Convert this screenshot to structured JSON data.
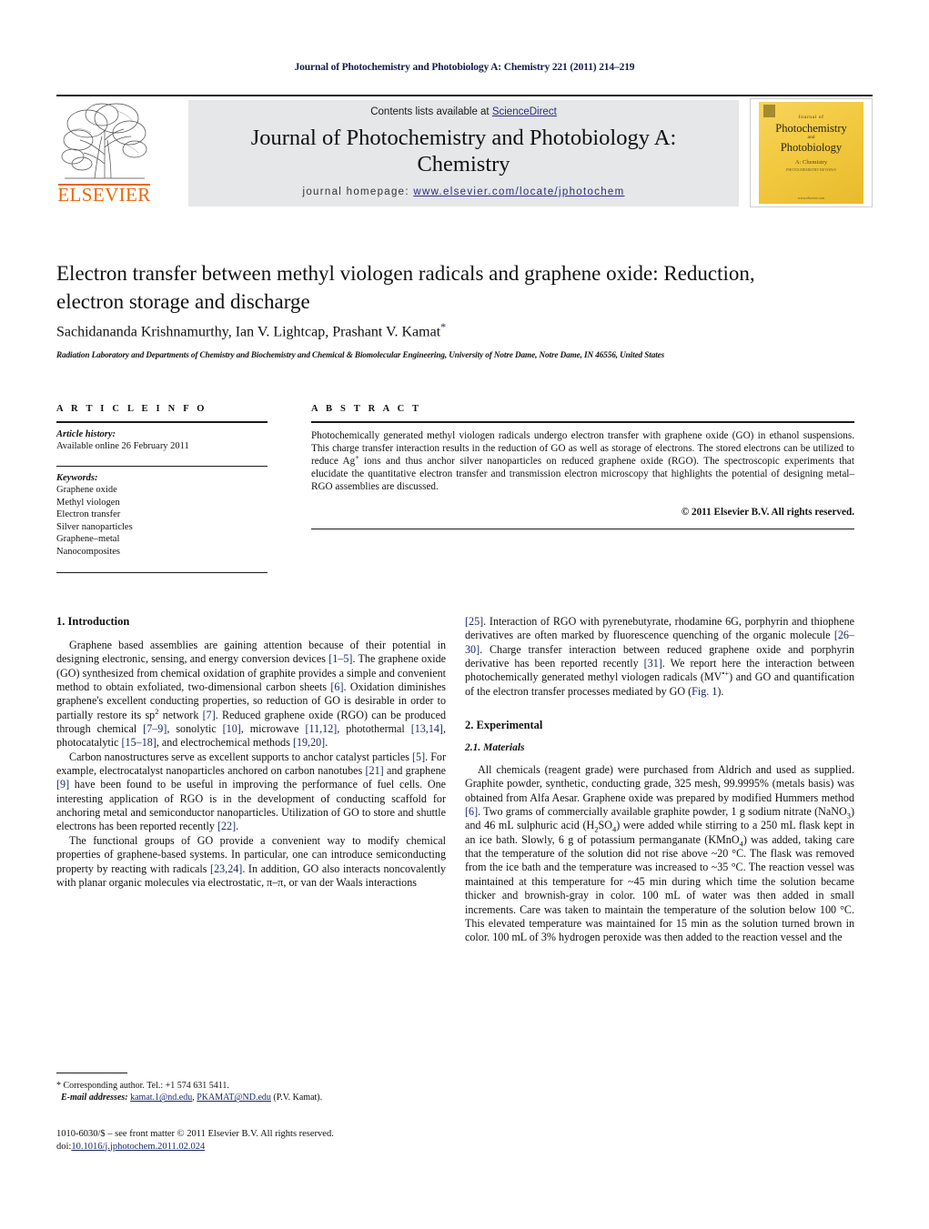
{
  "running_head": "Journal of Photochemistry and Photobiology A: Chemistry 221 (2011) 214–219",
  "header": {
    "contents_prefix": "Contents lists available at ",
    "sciencedirect": "ScienceDirect",
    "journal_title": "Journal of Photochemistry and Photobiology A: Chemistry",
    "homepage_label": "journal homepage: ",
    "homepage_url": "www.elsevier.com/locate/jphotochem",
    "publisher": "ELSEVIER",
    "publisher_color": "#eb6608",
    "band_color": "#e6e7e8",
    "link_color": "#2a2a8c"
  },
  "cover": {
    "line_journal_of": "Journal of",
    "line_photochemistry": "Photochemistry",
    "line_and": "and",
    "line_photobiology": "Photobiology",
    "line_section": "A: Chemistry",
    "line_section_sub": "PHOTOCHEMISTRY REVIEWS",
    "line_footer": "www.elsevier.com",
    "background_color": "#f2c940"
  },
  "article": {
    "title": "Electron transfer between methyl viologen radicals and graphene oxide: Reduction, electron storage and discharge",
    "authors": "Sachidananda Krishnamurthy, Ian V. Lightcap, Prashant V. Kamat",
    "corresponding_marker": "*",
    "affiliation": "Radiation Laboratory and Departments of Chemistry and Biochemistry and Chemical & Biomolecular Engineering, University of Notre Dame, Notre Dame, IN 46556, United States"
  },
  "article_info": {
    "heading": "A R T I C L E   I N F O",
    "history_label": "Article history:",
    "history_value": "Available online 26 February 2011",
    "keywords_label": "Keywords:",
    "keywords": [
      "Graphene oxide",
      "Methyl viologen",
      "Electron transfer",
      "Silver nanoparticles",
      "Graphene–metal",
      "Nanocomposites"
    ]
  },
  "abstract": {
    "heading": "A B S T R A C T",
    "text_part1": "Photochemically generated methyl viologen radicals undergo electron transfer with graphene oxide (GO) in ethanol suspensions. This charge transfer interaction results in the reduction of GO as well as storage of electrons. The stored electrons can be utilized to reduce Ag",
    "text_sup1": "+",
    "text_part2": " ions and thus anchor silver nanoparticles on reduced graphene oxide (RGO). The spectroscopic experiments that elucidate the quantitative electron transfer and transmission electron microscopy that highlights the potential of designing metal–RGO assemblies are discussed.",
    "copyright": "© 2011 Elsevier B.V. All rights reserved."
  },
  "sections": {
    "introduction_heading": "1.  Introduction",
    "experimental_heading": "2.  Experimental",
    "materials_heading": "2.1.  Materials"
  },
  "intro": {
    "p1_a": "Graphene based assemblies are gaining attention because of their potential in designing electronic, sensing, and energy conversion devices ",
    "p1_r1": "[1–5]",
    "p1_b": ". The graphene oxide (GO) synthesized from chemical oxidation of graphite provides a simple and convenient method to obtain exfoliated, two-dimensional carbon sheets ",
    "p1_r2": "[6]",
    "p1_c": ". Oxidation diminishes graphene's excellent conducting properties, so reduction of GO is desirable in order to partially restore its sp",
    "p1_sup": "2",
    "p1_d": " network ",
    "p1_r3": "[7]",
    "p1_e": ". Reduced graphene oxide (RGO) can be produced through chemical ",
    "p1_r4": "[7–9]",
    "p1_f": ", sonolytic ",
    "p1_r5": "[10]",
    "p1_g": ", microwave ",
    "p1_r6": "[11,12]",
    "p1_h": ", photothermal ",
    "p1_r7": "[13,14]",
    "p1_i": ", photocatalytic ",
    "p1_r8": "[15–18]",
    "p1_j": ", and electrochemical methods ",
    "p1_r9": "[19,20]",
    "p1_k": ".",
    "p2_a": "Carbon nanostructures serve as excellent supports to anchor catalyst particles ",
    "p2_r1": "[5]",
    "p2_b": ". For example, electrocatalyst nanoparticles anchored on carbon nanotubes ",
    "p2_r2": "[21]",
    "p2_c": " and graphene ",
    "p2_r3": "[9]",
    "p2_d": " have been found to be useful in improving the performance of fuel cells. One interesting application of RGO is in the development of conducting scaffold for anchoring metal and semiconductor nanoparticles. Utilization of GO to store and shuttle electrons has been reported recently ",
    "p2_r4": "[22]",
    "p2_e": ".",
    "p3_a": "The functional groups of GO provide a convenient way to modify chemical properties of graphene-based systems. In particular, one can introduce semiconducting property by reacting with radicals ",
    "p3_r1": "[23,24]",
    "p3_b": ". In addition, GO also interacts noncovalently with planar organic molecules via electrostatic, π–π, or van der Waals interactions ",
    "p3_r2": "[25]",
    "p3_c": ". Interaction of RGO with pyrenebutyrate, rhodamine 6G, porphyrin and thiophene derivatives are often marked by fluorescence quenching of the organic molecule ",
    "p3_r3": "[26–30]",
    "p3_d": ". Charge transfer interaction between reduced graphene oxide and porphyrin derivative has been reported recently ",
    "p3_r4": "[31]",
    "p3_e": ". We report here the interaction between photochemically generated methyl viologen radicals (MV",
    "p3_sup": "•+",
    "p3_f": ") and GO and quantification of the electron transfer processes mediated by GO (",
    "p3_fig": "Fig. 1",
    "p3_g": ")."
  },
  "materials": {
    "p1_a": "All chemicals (reagent grade) were purchased from Aldrich and used as supplied. Graphite powder, synthetic, conducting grade, 325 mesh, 99.9995% (metals basis) was obtained from Alfa Aesar. Graphene oxide was prepared by modified Hummers method ",
    "p1_r1": "[6]",
    "p1_b": ". Two grams of commercially available graphite powder, 1 g sodium nitrate (NaNO",
    "p1_sub1": "3",
    "p1_c": ") and 46 mL sulphuric acid (H",
    "p1_sub2": "2",
    "p1_d": "SO",
    "p1_sub3": "4",
    "p1_e": ") were added while stirring to a 250 mL flask kept in an ice bath. Slowly, 6 g of potassium permanganate (KMnO",
    "p1_sub4": "4",
    "p1_f": ") was added, taking care that the temperature of the solution did not rise above ~20 °C. The flask was removed from the ice bath and the temperature was increased to ~35 °C. The reaction vessel was maintained at this temperature for ~45 min during which time the solution became thicker and brownish-gray in color. 100 mL of water was then added in small increments. Care was taken to maintain the temperature of the solution below 100 °C. This elevated temperature was maintained for 15 min as the solution turned brown in color. 100 mL of 3% hydrogen peroxide was then added to the reaction vessel and the"
  },
  "footnote": {
    "marker": "*",
    "corresponding": "Corresponding author. Tel.: +1 574 631 5411.",
    "email_label": "E-mail addresses:",
    "email1": "kamat.1@nd.edu",
    "email2": "PKAMAT@ND.edu",
    "email_suffix": "(P.V. Kamat)."
  },
  "imprint": {
    "line1": "1010-6030/$ – see front matter © 2011 Elsevier B.V. All rights reserved.",
    "doi_label": "doi:",
    "doi": "10.1016/j.jphotochem.2011.02.024"
  }
}
